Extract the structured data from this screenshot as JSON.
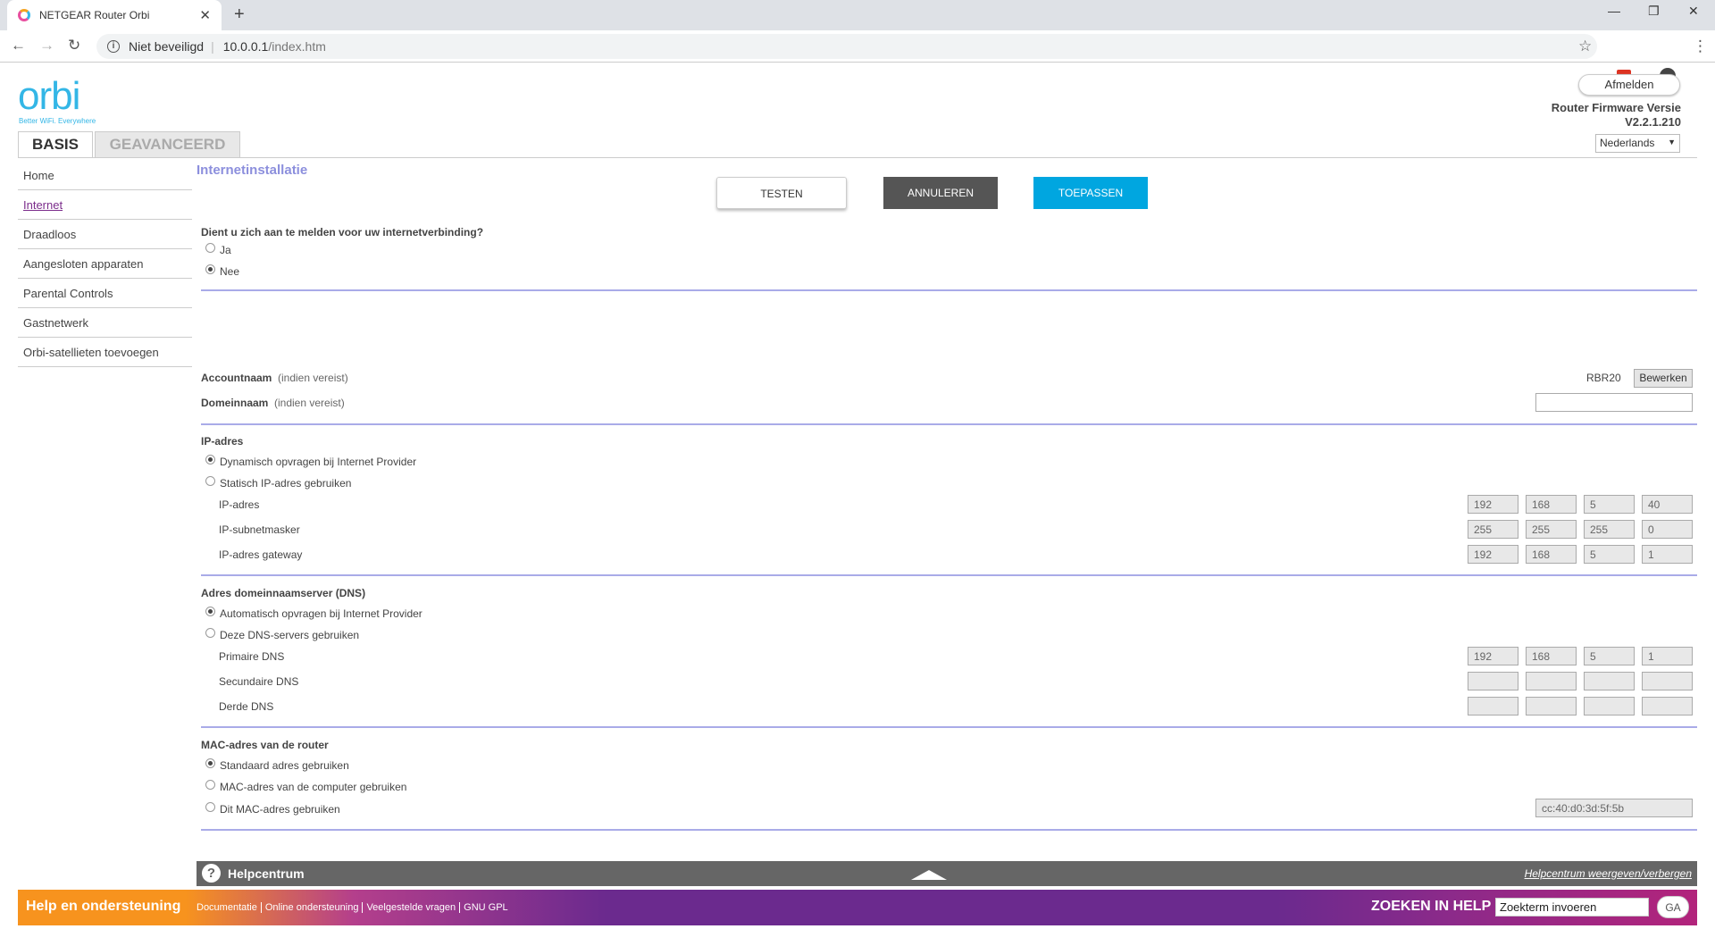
{
  "browser": {
    "tab_title": "NETGEAR Router Orbi",
    "close": "✕",
    "new_tab": "+",
    "security": "Niet beveiligd",
    "url_host": "10.0.0.1",
    "url_path": "/index.htm",
    "controls": {
      "minimize": "—",
      "restore": "❐",
      "close": "✕"
    }
  },
  "header": {
    "logo": "orbi",
    "tagline": "Better WiFi. Everywhere",
    "tabs": [
      "BASIS",
      "GEAVANCEERD"
    ],
    "logout": "Afmelden",
    "firmware_label": "Router Firmware Versie",
    "firmware_version": "V2.2.1.210",
    "language": "Nederlands"
  },
  "sidebar": {
    "items": [
      {
        "label": "Home"
      },
      {
        "label": "Internet"
      },
      {
        "label": "Draadloos"
      },
      {
        "label": "Aangesloten apparaten"
      },
      {
        "label": "Parental Controls"
      },
      {
        "label": "Gastnetwerk"
      },
      {
        "label": "Orbi-satellieten toevoegen"
      }
    ]
  },
  "main": {
    "title": "Internetinstallatie",
    "buttons": {
      "test": "TESTEN",
      "cancel": "ANNULEREN",
      "apply": "TOEPASSEN"
    },
    "login_question": "Dient u zich aan te melden voor uw internetverbinding?",
    "login_yes": "Ja",
    "login_no": "Nee",
    "account_label": "Accountnaam",
    "account_hint": "(indien vereist)",
    "account_value": "RBR20",
    "edit_button": "Bewerken",
    "domain_label": "Domeinnaam",
    "domain_hint": "(indien vereist)",
    "ip_section": "IP-adres",
    "ip_dynamic": "Dynamisch opvragen bij Internet Provider",
    "ip_static": "Statisch IP-adres gebruiken",
    "ip_address_label": "IP-adres",
    "ip_address": [
      "192",
      "168",
      "5",
      "40"
    ],
    "subnet_label": "IP-subnetmasker",
    "subnet": [
      "255",
      "255",
      "255",
      "0"
    ],
    "gateway_label": "IP-adres gateway",
    "gateway": [
      "192",
      "168",
      "5",
      "1"
    ],
    "dns_section": "Adres domeinnaamserver (DNS)",
    "dns_auto": "Automatisch opvragen bij Internet Provider",
    "dns_manual": "Deze DNS-servers gebruiken",
    "dns_primary_label": "Primaire DNS",
    "dns_primary": [
      "192",
      "168",
      "5",
      "1"
    ],
    "dns_secondary_label": "Secundaire DNS",
    "dns_secondary": [
      "",
      "",
      "",
      ""
    ],
    "dns_third_label": "Derde DNS",
    "dns_third": [
      "",
      "",
      "",
      ""
    ],
    "mac_section": "MAC-adres van de router",
    "mac_default": "Standaard adres gebruiken",
    "mac_computer": "MAC-adres van de computer gebruiken",
    "mac_custom": "Dit MAC-adres gebruiken",
    "mac_value": "cc:40:d0:3d:5f:5b"
  },
  "help": {
    "icon": "?",
    "title": "Helpcentrum",
    "toggle": "Helpcentrum weergeven/verbergen"
  },
  "footer": {
    "help_title": "Help en ondersteuning",
    "links": [
      "Documentatie",
      "Online ondersteuning",
      "Veelgestelde vragen",
      "GNU GPL"
    ],
    "search_title": "ZOEKEN IN HELP",
    "search_placeholder": "Zoekterm invoeren",
    "search_button": "GA"
  },
  "colors": {
    "accent": "#00a6e0",
    "brand": "#33b6e6",
    "section_line": "#a9abe8",
    "title": "#8c8fdd"
  }
}
